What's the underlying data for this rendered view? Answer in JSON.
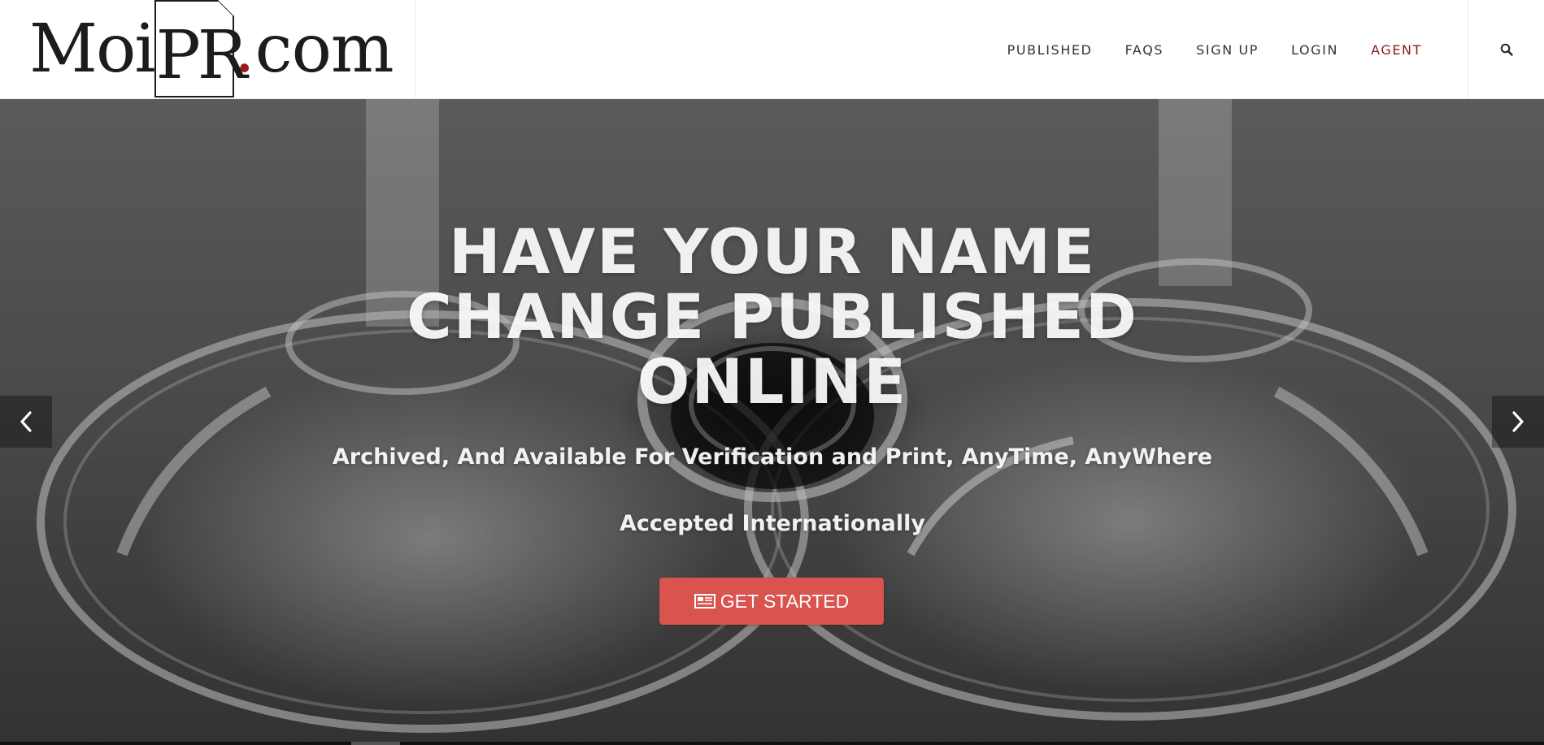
{
  "brand": {
    "logo_part1": "Moi",
    "logo_part2": "PR",
    "logo_dot": ".",
    "logo_part3": "com",
    "accent_color": "#8b1a1a"
  },
  "nav": {
    "items": [
      {
        "label": "PUBLISHED"
      },
      {
        "label": "FAQS"
      },
      {
        "label": "SIGN UP"
      },
      {
        "label": "LOGIN"
      },
      {
        "label": "AGENT"
      }
    ],
    "search_icon": "search-icon"
  },
  "hero": {
    "title": "HAVE YOUR NAME CHANGE PUBLISHED ONLINE",
    "subtitle": "Archived, And Available For Verification and Print, AnyTime, AnyWhere",
    "tagline": "Accepted Internationally",
    "cta_label": "GET STARTED",
    "cta_icon": "newspaper-icon",
    "cta_color": "#d9534f",
    "prev_icon": "chevron-left-icon",
    "next_icon": "chevron-right-icon"
  }
}
